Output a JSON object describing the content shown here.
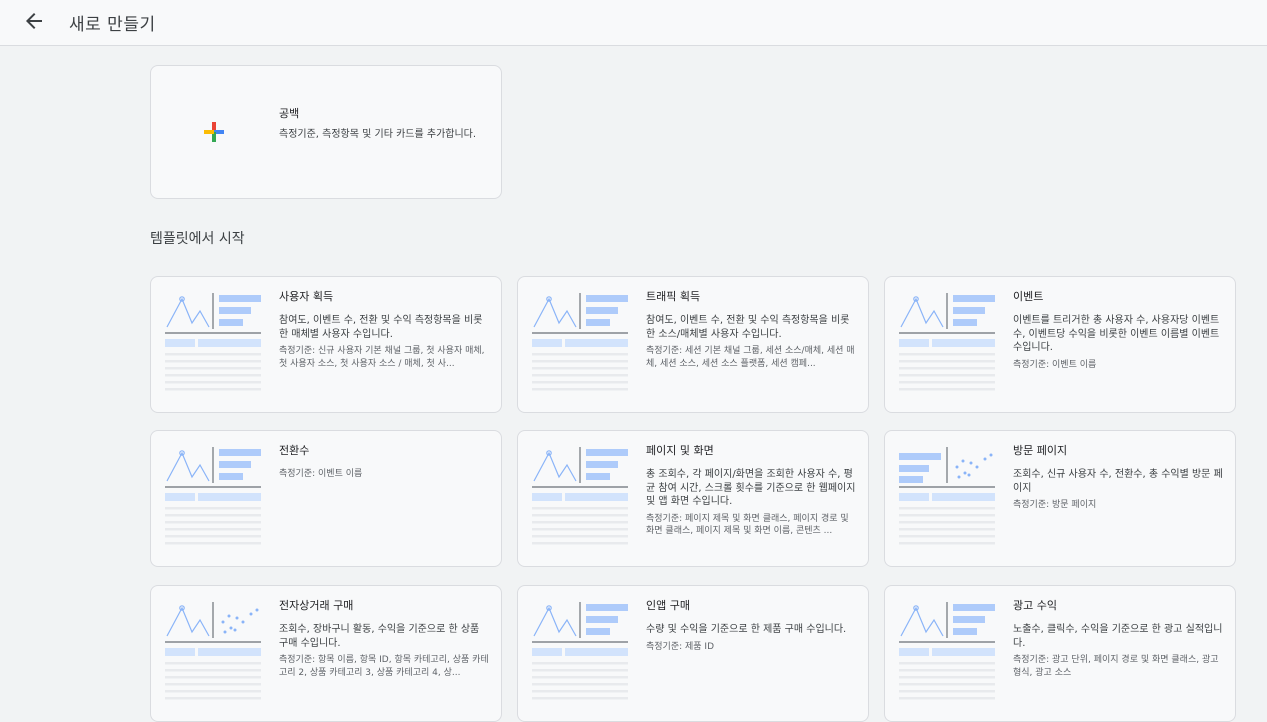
{
  "header": {
    "title": "새로 만들기",
    "back_icon": "arrow-back-icon"
  },
  "blank": {
    "title": "공백",
    "description": "측정기준, 측정항목 및 기타 카드를 추가합니다.",
    "icon": "plus-icon",
    "icon_colors": [
      "#4285f4",
      "#ea4335",
      "#fbbc04",
      "#34a853"
    ]
  },
  "section_title": "템플릿에서 시작",
  "thumbnail_colors": {
    "line": "#8ab4f8",
    "bar": "#aecbfa",
    "axis": "#80868b",
    "row": "#e8eaed",
    "header_row": "#d2e3fc"
  },
  "templates": [
    {
      "title": "사용자 획득",
      "description": "참여도, 이벤트 수, 전환 및 수익 측정항목을 비롯한 매체별 사용자 수입니다.",
      "meta": "측정기준: 신규 사용자 기본 채널 그룹, 첫 사용자 매체, 첫 사용자 소스, 첫 사용자 소스 / 매체, 첫 사...",
      "thumb": "line-bars"
    },
    {
      "title": "트래픽 획득",
      "description": "참여도, 이벤트 수, 전환 및 수익 측정항목을 비롯한 소스/매체별 사용자 수입니다.",
      "meta": "측정기준: 세션 기본 채널 그룹, 세션 소스/매체, 세션 매체, 세션 소스, 세션 소스 플랫폼, 세션 캠페...",
      "thumb": "line-bars"
    },
    {
      "title": "이벤트",
      "description": "이벤트를 트리거한 총 사용자 수, 사용자당 이벤트 수, 이벤트당 수익을 비롯한 이벤트 이름별 이벤트 수입니다.",
      "meta": "측정기준: 이벤트 이름",
      "thumb": "line-bars"
    },
    {
      "title": "전환수",
      "description": "",
      "meta": "측정기준: 이벤트 이름",
      "thumb": "line-bars"
    },
    {
      "title": "페이지 및 화면",
      "description": "총 조회수, 각 페이지/화면을 조회한 사용자 수, 평균 참여 시간, 스크롤 횟수를 기준으로 한 웹페이지 및 앱 화면 수입니다.",
      "meta": "측정기준: 페이지 제목 및 화면 클래스, 페이지 경로 및 화면 클래스, 페이지 제목 및 화면 이름, 콘텐츠 ...",
      "thumb": "line-bars"
    },
    {
      "title": "방문 페이지",
      "description": "조회수, 신규 사용자 수, 전환수, 총 수익별 방문 페이지",
      "meta": "측정기준: 방문 페이지",
      "thumb": "bars-scatter"
    },
    {
      "title": "전자상거래 구매",
      "description": "조회수, 장바구니 활동, 수익을 기준으로 한 상품 구매 수입니다.",
      "meta": "측정기준: 항목 이름, 항목 ID, 항목 카테고리, 상품 카테고리 2, 상품 카테고리 3, 상품 카테고리 4, 상...",
      "thumb": "line-scatter"
    },
    {
      "title": "인앱 구매",
      "description": "수량 및 수익을 기준으로 한 제품 구매 수입니다.",
      "meta": "측정기준: 제품 ID",
      "thumb": "line-bars"
    },
    {
      "title": "광고 수익",
      "description": "노출수, 클릭수, 수익을 기준으로 한 광고 실적입니다.",
      "meta": "측정기준: 광고 단위, 페이지 경로 및 화면 클래스, 광고 형식, 광고 소스",
      "thumb": "line-bars"
    }
  ]
}
